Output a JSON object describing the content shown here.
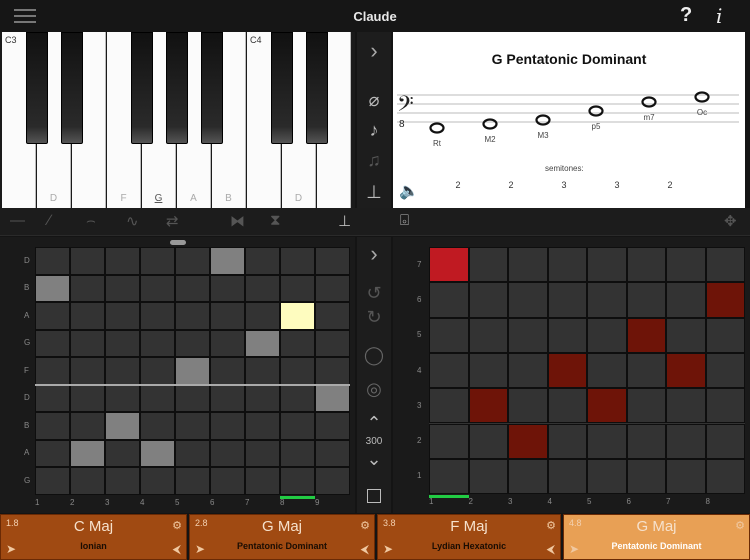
{
  "app": {
    "title": "Claude"
  },
  "keyboard": {
    "octave_labels": [
      "C3",
      "C4"
    ],
    "white_keys": [
      "",
      "D",
      "",
      "F",
      "G",
      "A",
      "B",
      "",
      "D",
      ""
    ],
    "highlight_key": "G"
  },
  "scale_panel": {
    "title": "G  Pentatonic Dominant",
    "clef": "bass",
    "octave_mark": "8",
    "intervals": [
      "Rt",
      "M2",
      "M3",
      "p5",
      "m7",
      "Oc"
    ],
    "semitones_label": "semitones:",
    "semitones": [
      "2",
      "2",
      "3",
      "3",
      "2"
    ]
  },
  "left_grid": {
    "row_labels": [
      "D",
      "B",
      "A",
      "G",
      "F",
      "D",
      "B",
      "A",
      "G"
    ],
    "col_labels": [
      "1",
      "2",
      "3",
      "4",
      "5",
      "6",
      "7",
      "8",
      "9"
    ],
    "tempo": "300",
    "colors": {
      "empty": "#333333",
      "filled": "#808080",
      "active": "#fefcbf"
    }
  },
  "right_grid": {
    "row_labels": [
      "7",
      "6",
      "5",
      "4",
      "3",
      "2",
      "1"
    ],
    "col_labels": [
      "1",
      "2",
      "3",
      "4",
      "5",
      "6",
      "7",
      "8"
    ],
    "colors": {
      "empty": "#333333",
      "filled": "#6e1408",
      "active": "#c01a22"
    }
  },
  "chord_slots": [
    {
      "num": "1.8",
      "chord": "C Maj",
      "mode": "Ionian",
      "active": false
    },
    {
      "num": "2.8",
      "chord": "G Maj",
      "mode": "Pentatonic Dominant",
      "active": false
    },
    {
      "num": "3.8",
      "chord": "F Maj",
      "mode": "Lydian Hexatonic",
      "active": false
    },
    {
      "num": "4.8",
      "chord": "G Maj",
      "mode": "Pentatonic Dominant",
      "active": true
    }
  ],
  "colors": {
    "slot": "#a04a12",
    "slot_active": "#e8a055",
    "progress": "#22cc44"
  }
}
